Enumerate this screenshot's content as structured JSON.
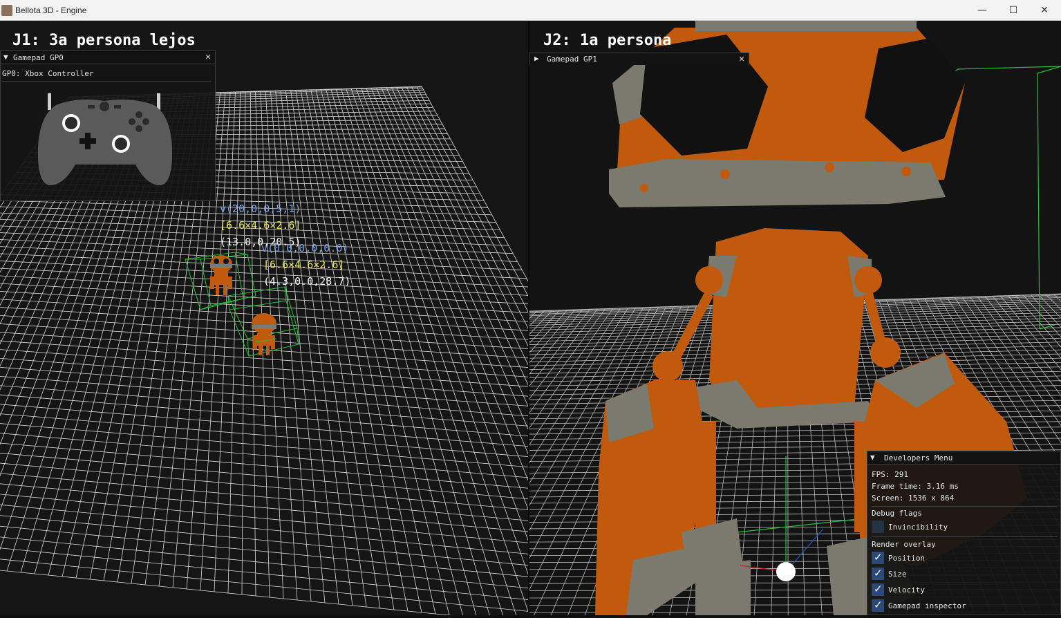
{
  "window": {
    "title": "Bellota 3D - Engine",
    "min_icon": "minimize-icon",
    "max_icon": "maximize-icon",
    "close_icon": "close-icon"
  },
  "viewport1": {
    "title": "J1: 3a persona lejos",
    "labels": {
      "vel_a": "v(20,0,0,5,1)",
      "size_a": "[6.6×4.6×2.6]",
      "pos_a": "(13.0,0,20.5)",
      "vel_b": "v(0.0,0,0,0.0)",
      "size_b": "[6.6×4.6×2.6]",
      "pos_b": "(4.3,0.0,28.7)"
    }
  },
  "viewport2": {
    "title": "J2: 1a persona"
  },
  "gamepad0": {
    "title": "Gamepad GP0",
    "controller": "GP0: Xbox Controller"
  },
  "gamepad1": {
    "title": "Gamepad GP1"
  },
  "devmenu": {
    "title": "Developers Menu",
    "fps": "FPS: 291",
    "frame_time": "Frame time: 3.16 ms",
    "screen": "Screen: 1536 x 864",
    "debug_flags": "Debug flags",
    "invincibility": "Invincibility",
    "render_overlay": "Render overlay",
    "position": "Position",
    "size": "Size",
    "velocity": "Velocity",
    "gamepad_inspector": "Gamepad inspector"
  },
  "colors": {
    "accent_checkbox": "#2b4a78",
    "robot_orange": "#c25a0e",
    "robot_gray": "#7a7a6e",
    "bbox_green": "#22c33a",
    "vel_label": "#7aa7e6",
    "size_label": "#e6e65a"
  }
}
